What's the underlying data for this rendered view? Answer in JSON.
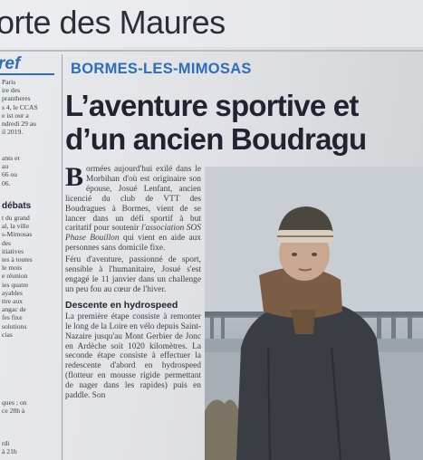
{
  "header": {
    "masthead": "orte des Maures"
  },
  "left_column": {
    "kicker": "ref",
    "block1": [
      "Paris",
      "ire des",
      "prantheres",
      "s 4, le CCAS",
      "e ist our a",
      "ndredi 29 au",
      "il 2019."
    ],
    "block2": [
      "ants et",
      "au",
      "66 ou",
      "06."
    ],
    "subhead2": "débats",
    "block3": [
      "t du grand",
      "al, la ville",
      "s-Mimosas",
      "des",
      "itiatives",
      "tes à toutes",
      "le mois",
      "e réunion",
      "ies quatre",
      "ayables",
      "ttre aux",
      "angac de",
      "fes fixe",
      "solutions",
      "cias"
    ],
    "block4": [
      "ques ; on",
      "ce 28h à"
    ],
    "block5": [
      "rdi",
      "à 21h"
    ]
  },
  "article": {
    "section": "BORMES-LES-MIMOSAS",
    "headline_line1": "L’aventure sportive et",
    "headline_line2": "d’un ancien Boudragu",
    "dropcap": "B",
    "para1": "ormées aujourd'hui exilé dans le Morbihan d'où est originaire son épouse, Josué Lenfant, ancien licencié du club de VTT des Boudragues à Bormes, vient de se lancer dans un défi sportif à but caritatif pour soutenir",
    "para1_italic": "l'association SOS Phase Bouillon",
    "para1_end": "qui vient en aide aux personnes sans domicile fixe.",
    "para2": "Féru d'aventure, passionné de sport, sensible à l'humanitaire, Josué s'est engagé le 11 janvier dans un challenge un peu fou au cœur de l'hiver.",
    "subhead": "Descente en hydrospeed",
    "para3": "La première étape consiste à remonter le long de la Loire en vélo depuis Saint-Nazaire jusqu'au Mont Gerbier de Jonc en Ardèche soit 1020 kilomètres. La seconde étape consiste à effectuer la redescente d'abord en hydrospeed (flotteur en mousse rigide permettant de nager dans les rapides) puis en paddle. Son"
  },
  "photo": {
    "subject": "man-in-winter-clothing"
  }
}
